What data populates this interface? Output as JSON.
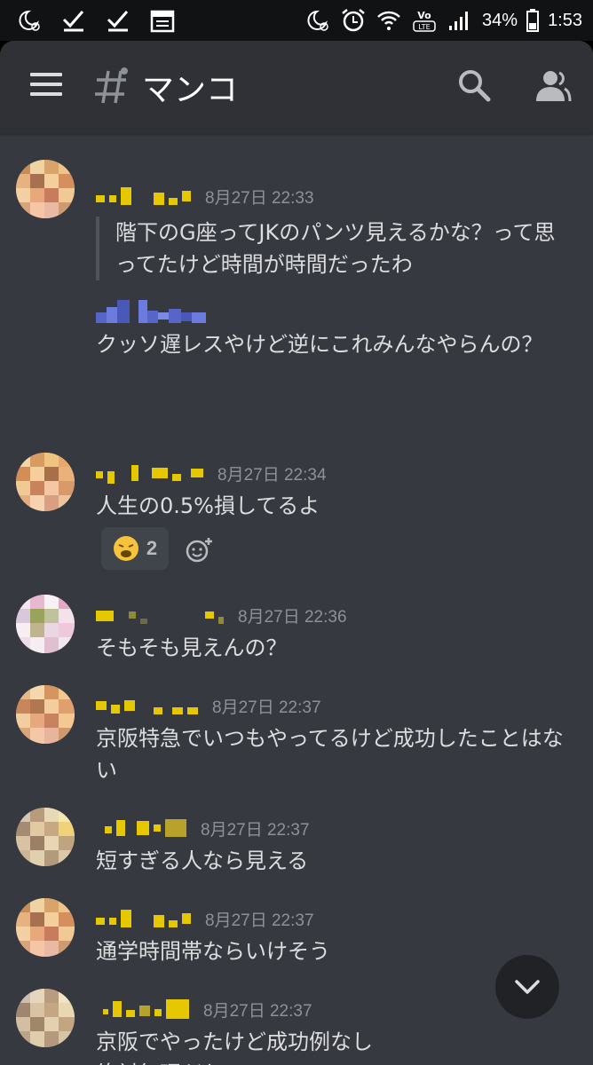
{
  "status_bar": {
    "battery": "34%",
    "time": "1:53"
  },
  "header": {
    "channel_name": "マンコ"
  },
  "colors": {
    "background": "#36393f",
    "header": "#2f3136",
    "text": "#dcddde",
    "timestamp": "#8e9297",
    "name_color": "#e6c800",
    "quote_bar": "#4f545c",
    "name_color_blue": "#5865c8"
  },
  "messages": [
    {
      "timestamp": "8月27日 22:33",
      "quote": "階下のG座ってJKのパンツ見えるかな？って思ってたけど時間が時間だったわ",
      "text": "クッソ遅レスやけど逆にこれみんなやらんの？"
    },
    {
      "timestamp": "8月27日 22:34",
      "text": "人生の0.5%損してるよ",
      "reaction": {
        "icon": "weary-face-emoji",
        "count": "2"
      }
    },
    {
      "timestamp": "8月27日 22:36",
      "text": "そもそも見えんの？"
    },
    {
      "timestamp": "8月27日 22:37",
      "text": "京阪特急でいつもやってるけど成功したことはない"
    },
    {
      "timestamp": "8月27日 22:37",
      "text": "短すぎる人なら見える"
    },
    {
      "timestamp": "8月27日 22:37",
      "text": "通学時間帯ならいけそう"
    },
    {
      "timestamp": "8月27日 22:37",
      "text": "京阪でやったけど成功例なし\n絶対無理だわ"
    }
  ]
}
